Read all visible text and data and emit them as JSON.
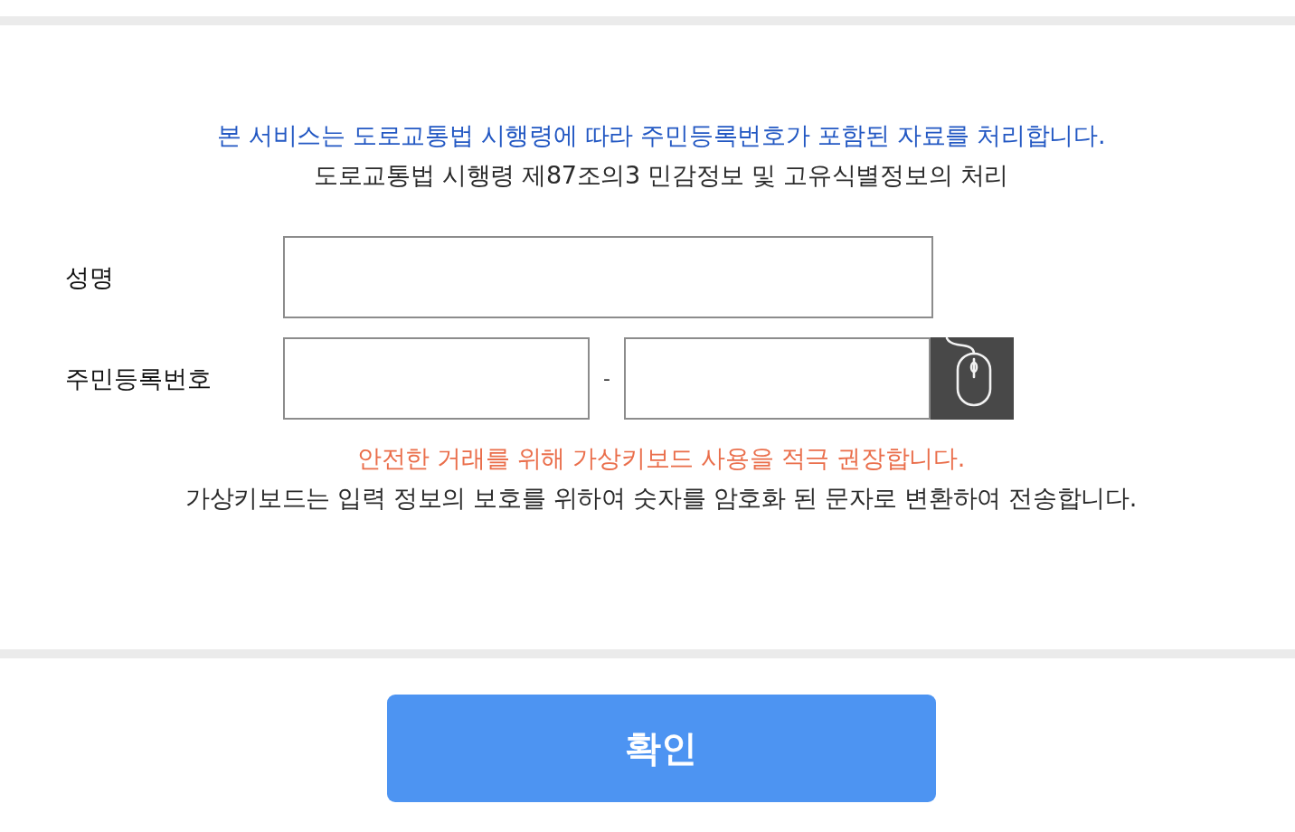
{
  "notice": {
    "title": "본 서비스는 도로교통법 시행령에 따라 주민등록번호가 포함된 자료를 처리합니다.",
    "subtitle": "도로교통법 시행령 제87조의3 민감정보 및 고유식별정보의 처리"
  },
  "form": {
    "fields": [
      {
        "kind": "single",
        "label": "성명"
      },
      {
        "kind": "split",
        "label": "주민등록번호",
        "separator": "-",
        "mouse_button": true
      }
    ]
  },
  "keyboard_notice": {
    "warning": "안전한 거래를 위해 가상키보드 사용을 적극 권장합니다.",
    "description": "가상키보드는 입력 정보의 보호를 위하여 숫자를 암호화 된 문자로 변환하여 전송합니다."
  },
  "confirm_button": {
    "label": "확인"
  }
}
